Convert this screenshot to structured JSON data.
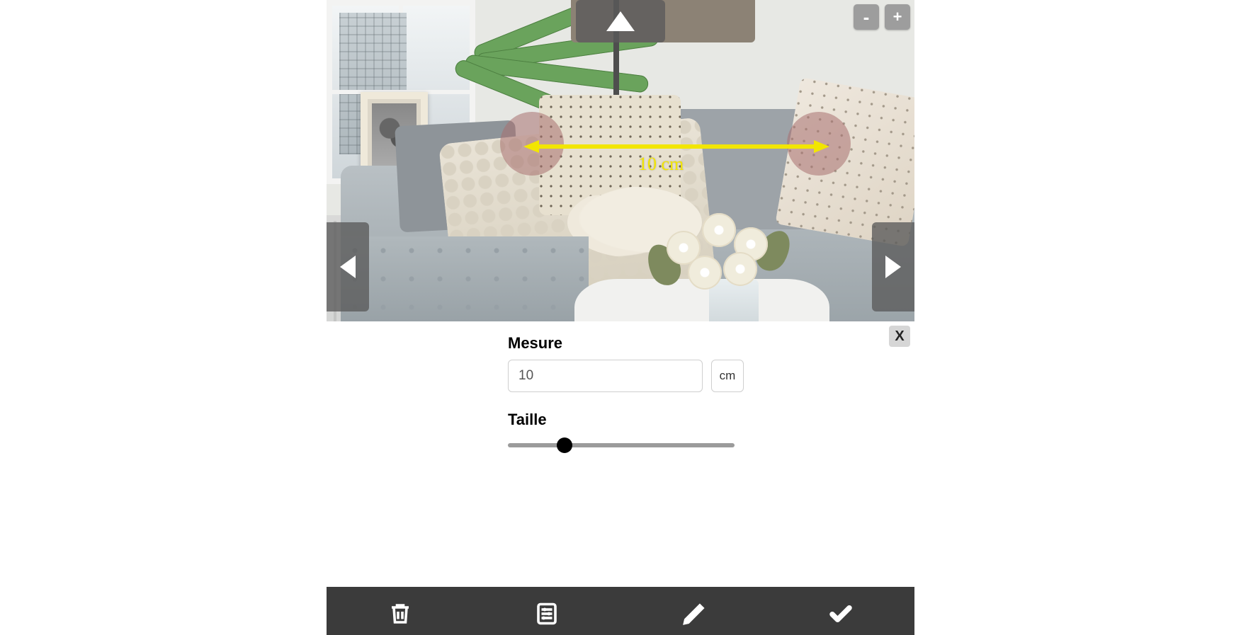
{
  "measurement": {
    "overlay_label": "10 cm",
    "arrow_color": "#f2e600",
    "handle_color": "rgba(168,112,112,.55)"
  },
  "zoom": {
    "minus": "-",
    "plus": "+"
  },
  "panel": {
    "close": "X",
    "measure_label": "Mesure",
    "measure_value": "10",
    "unit": "cm",
    "size_label": "Taille",
    "slider_percent": 25
  },
  "toolbar": {
    "delete": "delete",
    "settings": "settings",
    "edit": "edit",
    "confirm": "confirm"
  }
}
